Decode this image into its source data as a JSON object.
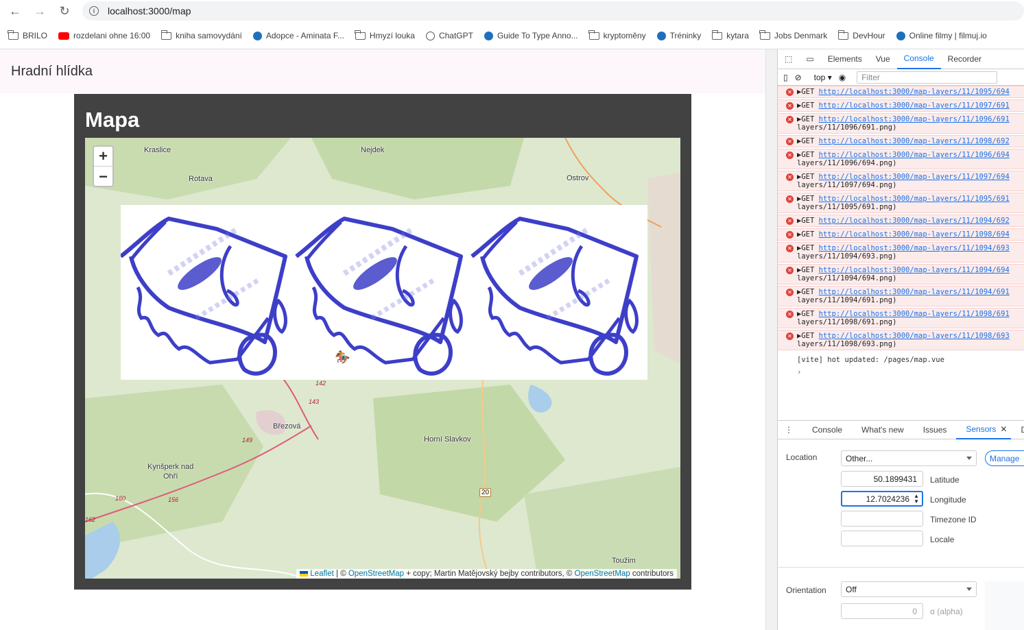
{
  "browser": {
    "url": "localhost:3000/map",
    "bookmarks": [
      {
        "label": "BRILO",
        "icon": "folder-icon"
      },
      {
        "label": "rozdelani ohne 16:00",
        "icon": "youtube-icon"
      },
      {
        "label": "kniha samovydání",
        "icon": "folder-icon"
      },
      {
        "label": "Adopce - Aminata F...",
        "icon": "site-icon"
      },
      {
        "label": "Hmyzí louka",
        "icon": "folder-icon"
      },
      {
        "label": "ChatGPT",
        "icon": "chatgpt-icon"
      },
      {
        "label": "Guide To Type Anno...",
        "icon": "site-icon"
      },
      {
        "label": "kryptoměny",
        "icon": "folder-icon"
      },
      {
        "label": "Tréninky",
        "icon": "site-icon"
      },
      {
        "label": "kytara",
        "icon": "folder-icon"
      },
      {
        "label": "Jobs Denmark",
        "icon": "folder-icon"
      },
      {
        "label": "DevHour",
        "icon": "folder-icon"
      },
      {
        "label": "Online filmy | filmuj.io",
        "icon": "site-icon"
      }
    ]
  },
  "page": {
    "header_title": "Hradní hlídka",
    "card_title": "Mapa",
    "map": {
      "zoom_in": "+",
      "zoom_out": "−",
      "places": [
        "Kraslice",
        "Nejdek",
        "Rotava",
        "Ostrov",
        "Březová",
        "Horní Slavkov",
        "Kynšperk nad",
        "Ohří",
        "Toužim"
      ],
      "road_numbers": [
        "142",
        "143",
        "149",
        "160",
        "156",
        "162"
      ],
      "road_shield": "20",
      "attribution": {
        "leaflet": "Leaflet",
        "sep1": " | © ",
        "osm1": "OpenStreetMap",
        "mid": " + copy; Martin Matějovský bejby contributors, © ",
        "osm2": "OpenStreetMap",
        "end": " contributors"
      }
    }
  },
  "devtools": {
    "tabs": [
      "Elements",
      "Vue",
      "Console",
      "Recorder"
    ],
    "active_tab": "Console",
    "context": "top",
    "filter_placeholder": "Filter",
    "errors": [
      {
        "method": "GET",
        "url": "http://localhost:3000/map-layers/11/1095/694",
        "cont": ""
      },
      {
        "method": "GET",
        "url": "http://localhost:3000/map-layers/11/1097/691",
        "cont": ""
      },
      {
        "method": "GET",
        "url": "http://localhost:3000/map-layers/11/1096/691",
        "cont": "layers/11/1096/691.png)"
      },
      {
        "method": "GET",
        "url": "http://localhost:3000/map-layers/11/1098/692",
        "cont": ""
      },
      {
        "method": "GET",
        "url": "http://localhost:3000/map-layers/11/1096/694",
        "cont": "layers/11/1096/694.png)"
      },
      {
        "method": "GET",
        "url": "http://localhost:3000/map-layers/11/1097/694",
        "cont": "layers/11/1097/694.png)"
      },
      {
        "method": "GET",
        "url": "http://localhost:3000/map-layers/11/1095/691",
        "cont": "layers/11/1095/691.png)"
      },
      {
        "method": "GET",
        "url": "http://localhost:3000/map-layers/11/1094/692",
        "cont": ""
      },
      {
        "method": "GET",
        "url": "http://localhost:3000/map-layers/11/1098/694",
        "cont": ""
      },
      {
        "method": "GET",
        "url": "http://localhost:3000/map-layers/11/1094/693",
        "cont": "layers/11/1094/693.png)"
      },
      {
        "method": "GET",
        "url": "http://localhost:3000/map-layers/11/1094/694",
        "cont": "layers/11/1094/694.png)"
      },
      {
        "method": "GET",
        "url": "http://localhost:3000/map-layers/11/1094/691",
        "cont": "layers/11/1094/691.png)"
      },
      {
        "method": "GET",
        "url": "http://localhost:3000/map-layers/11/1098/691",
        "cont": "layers/11/1098/691.png)"
      },
      {
        "method": "GET",
        "url": "http://localhost:3000/map-layers/11/1098/693",
        "cont": "layers/11/1098/693.png)"
      }
    ],
    "info_message": "[vite] hot updated: /pages/map.vue",
    "prompt": "›",
    "drawer_tabs": [
      "Console",
      "What's new",
      "Issues",
      "Sensors",
      "Develo"
    ],
    "active_drawer_tab": "Sensors",
    "sensors": {
      "location_label": "Location",
      "location_value": "Other...",
      "manage_label": "Manage",
      "latitude_value": "50.1899431",
      "latitude_label": "Latitude",
      "longitude_value": "12.7024236",
      "longitude_label": "Longitude",
      "timezone_value": "",
      "timezone_label": "Timezone ID",
      "locale_value": "",
      "locale_label": "Locale",
      "orientation_label": "Orientation",
      "orientation_value": "Off",
      "alpha_value": "0",
      "alpha_label": "α (alpha)"
    }
  }
}
